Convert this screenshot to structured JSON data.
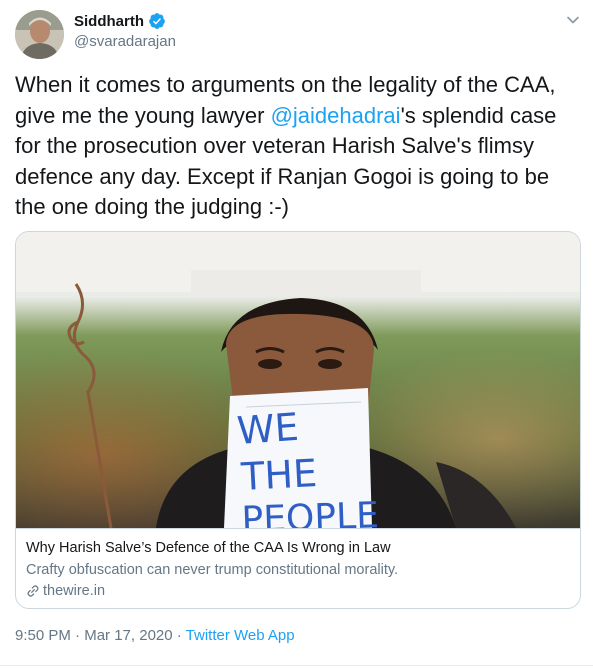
{
  "author": {
    "name": "Siddharth",
    "handle": "@svaradarajan"
  },
  "icons": {
    "verified": "verified-badge-icon",
    "caret": "chevron-down-icon",
    "link": "link-icon"
  },
  "tweet": {
    "text_before": "When it comes to arguments on the legality of the CAA,\ngive me the young lawyer ",
    "mention": "@jaidehadrai",
    "text_after": "'s splendid case\nfor the prosecution over veteran Harish Salve's flimsy\ndefence any day. Except if Ranjan Gogoi is going to be\nthe one doing the judging :-)"
  },
  "card": {
    "image_sign_text": "WE THE PEOPLE",
    "title": "Why Harish Salve’s Defence of the CAA Is Wrong in Law",
    "description": "Crafty obfuscation can never trump constitutional morality.",
    "domain": "thewire.in"
  },
  "meta": {
    "time": "9:50 PM",
    "separator": " · ",
    "date": "Mar 17, 2020",
    "app": "Twitter Web App"
  },
  "colors": {
    "link_blue": "#1da1f2",
    "secondary_text": "#657786",
    "border": "#ccd6dd"
  }
}
